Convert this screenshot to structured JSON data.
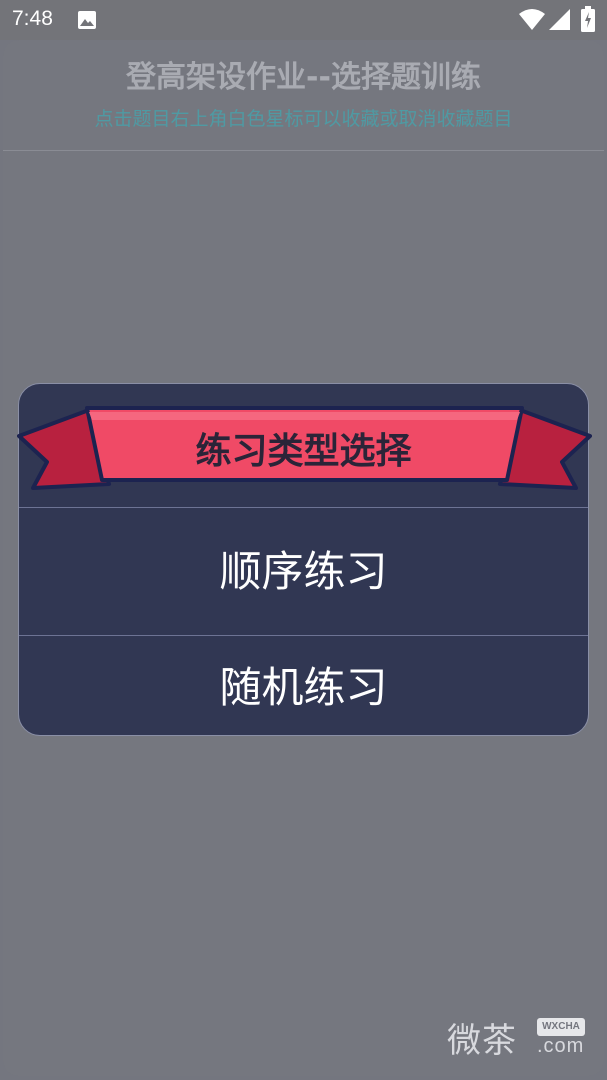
{
  "status_bar": {
    "time": "7:48",
    "icons": [
      "image-icon",
      "wifi-icon",
      "signal-icon",
      "battery-icon"
    ]
  },
  "header": {
    "title": "登高架设作业--选择题训练",
    "subtitle": "点击题目右上角白色星标可以收藏或取消收藏题目"
  },
  "dialog": {
    "title": "练习类型选择",
    "options": [
      {
        "label": "顺序练习"
      },
      {
        "label": "随机练习"
      }
    ]
  },
  "watermark": {
    "text": "微茶",
    "badge": "WXCHA",
    "domain": ".com"
  },
  "colors": {
    "overlay_bg": "#74767f",
    "dialog_bg": "#313753",
    "ribbon_red": "#f04a66",
    "ribbon_dark_red": "#b8213f",
    "ribbon_outline": "#1c2350",
    "subtitle_teal": "#4f9aa3"
  }
}
